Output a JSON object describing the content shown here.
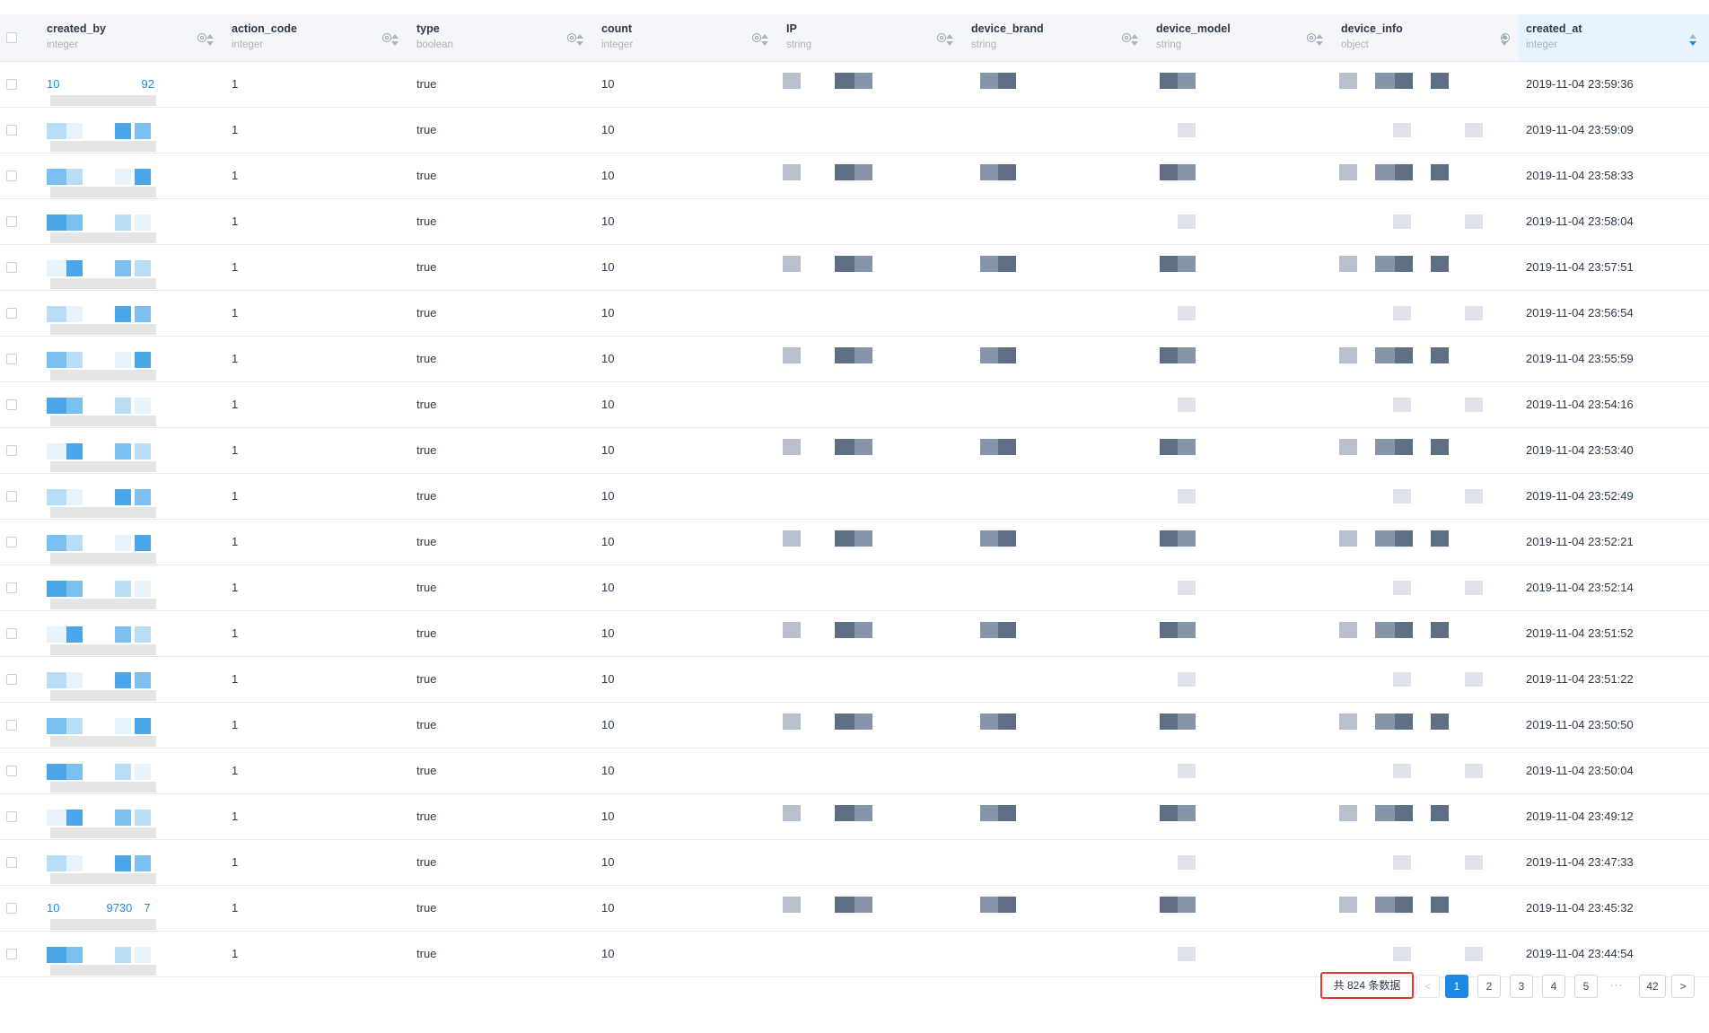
{
  "columns": [
    {
      "name": "created_by",
      "type": "integer"
    },
    {
      "name": "action_code",
      "type": "integer"
    },
    {
      "name": "type",
      "type": "boolean"
    },
    {
      "name": "count",
      "type": "integer"
    },
    {
      "name": "IP",
      "type": "string"
    },
    {
      "name": "device_brand",
      "type": "string"
    },
    {
      "name": "device_model",
      "type": "string"
    },
    {
      "name": "device_info",
      "type": "object"
    },
    {
      "name": "created_at",
      "type": "integer"
    }
  ],
  "rows": [
    {
      "created_by": "10       92",
      "action_code": "1",
      "type": "true",
      "count": "10",
      "created_at": "2019-11-04 23:59:36"
    },
    {
      "created_by": "",
      "action_code": "1",
      "type": "true",
      "count": "10",
      "created_at": "2019-11-04 23:59:09"
    },
    {
      "created_by": "",
      "action_code": "1",
      "type": "true",
      "count": "10",
      "created_at": "2019-11-04 23:58:33"
    },
    {
      "created_by": "",
      "action_code": "1",
      "type": "true",
      "count": "10",
      "created_at": "2019-11-04 23:58:04"
    },
    {
      "created_by": "",
      "action_code": "1",
      "type": "true",
      "count": "10",
      "created_at": "2019-11-04 23:57:51"
    },
    {
      "created_by": "",
      "action_code": "1",
      "type": "true",
      "count": "10",
      "created_at": "2019-11-04 23:56:54"
    },
    {
      "created_by": "",
      "action_code": "1",
      "type": "true",
      "count": "10",
      "created_at": "2019-11-04 23:55:59"
    },
    {
      "created_by": "",
      "action_code": "1",
      "type": "true",
      "count": "10",
      "created_at": "2019-11-04 23:54:16"
    },
    {
      "created_by": "",
      "action_code": "1",
      "type": "true",
      "count": "10",
      "created_at": "2019-11-04 23:53:40"
    },
    {
      "created_by": "",
      "action_code": "1",
      "type": "true",
      "count": "10",
      "created_at": "2019-11-04 23:52:49"
    },
    {
      "created_by": "",
      "action_code": "1",
      "type": "true",
      "count": "10",
      "created_at": "2019-11-04 23:52:21"
    },
    {
      "created_by": "",
      "action_code": "1",
      "type": "true",
      "count": "10",
      "created_at": "2019-11-04 23:52:14"
    },
    {
      "created_by": "",
      "action_code": "1",
      "type": "true",
      "count": "10",
      "created_at": "2019-11-04 23:51:52"
    },
    {
      "created_by": "",
      "action_code": "1",
      "type": "true",
      "count": "10",
      "created_at": "2019-11-04 23:51:22"
    },
    {
      "created_by": "",
      "action_code": "1",
      "type": "true",
      "count": "10",
      "created_at": "2019-11-04 23:50:50"
    },
    {
      "created_by": "",
      "action_code": "1",
      "type": "true",
      "count": "10",
      "created_at": "2019-11-04 23:50:04"
    },
    {
      "created_by": "",
      "action_code": "1",
      "type": "true",
      "count": "10",
      "created_at": "2019-11-04 23:49:12"
    },
    {
      "created_by": "",
      "action_code": "1",
      "type": "true",
      "count": "10",
      "created_at": "2019-11-04 23:47:33"
    },
    {
      "created_by": "10    9730 7",
      "action_code": "1",
      "type": "true",
      "count": "10",
      "created_at": "2019-11-04 23:45:32"
    },
    {
      "created_by": "",
      "action_code": "1",
      "type": "true",
      "count": "10",
      "created_at": "2019-11-04 23:44:54"
    }
  ],
  "pagination": {
    "total_label": "共 824 条数据",
    "prev": "<",
    "next": ">",
    "pages": [
      "1",
      "2",
      "3",
      "4",
      "5"
    ],
    "ellipsis": "···",
    "last": "42",
    "current": "1"
  },
  "colors": {
    "link": "#1a8ee1",
    "accent": "#1e88e5",
    "highlight": "#e53935"
  }
}
